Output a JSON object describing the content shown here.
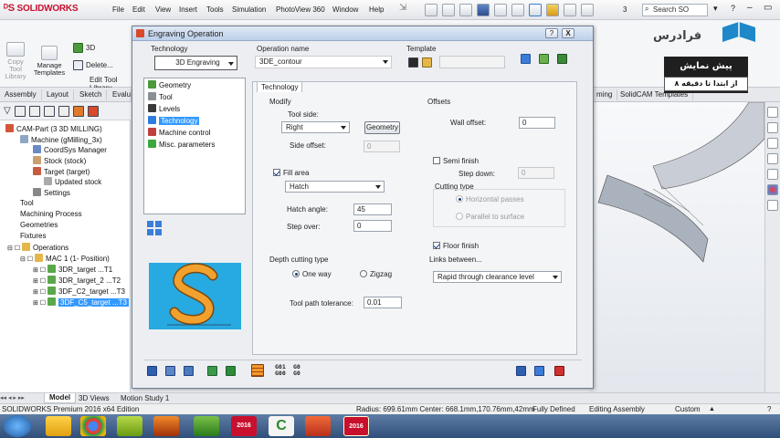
{
  "app": {
    "brand": "SOLIDWORKS",
    "menus": [
      "File",
      "Edit",
      "View",
      "Insert",
      "Tools",
      "Simulation",
      "PhotoView 360",
      "Window",
      "Help"
    ],
    "search_placeholder": "Search SO",
    "toolbar_item_3": "3"
  },
  "ribbon": {
    "copy_tool_library": "Copy\nTool\nLibrary",
    "manage_templates": "Manage\nTemplates",
    "btn_3d": "3D",
    "btn_delete": "Delete...",
    "btn_edit_tool_library": "Edit Tool Library"
  },
  "command_tabs": [
    "Assembly",
    "Layout",
    "Sketch",
    "Evalu"
  ],
  "command_tabs_right": [
    "ming",
    "SolidCAM Templates"
  ],
  "tree": {
    "root": "CAM-Part (3 3D MILLING)",
    "items": [
      "Machine (gMilling_3x)",
      "CoordSys Manager",
      "Stock (stock)",
      "Target (target)",
      "Updated stock",
      "Settings",
      "Tool",
      "Machining Process",
      "Geometries",
      "Fixtures",
      "Operations",
      "MAC 1 (1- Position)",
      "3DR_target ...T1",
      "3DR_target_2 ...T2",
      "3DF_C2_target ...T3",
      "3DF_C5_target ...T3"
    ]
  },
  "dialog": {
    "title": "Engraving Operation",
    "help": "?",
    "close": "X",
    "technology_label": "Technology",
    "technology_value": "3D Engraving",
    "operation_name_label": "Operation name",
    "operation_name_value": "3DE_contour",
    "template_label": "Template",
    "nav": [
      "Geometry",
      "Tool",
      "Levels",
      "Technology",
      "Machine control",
      "Misc. parameters"
    ],
    "tab": "Technology",
    "modify_title": "Modify",
    "tool_side_label": "Tool side:",
    "tool_side_value": "Right",
    "geometry_button": "Geometry",
    "side_offset_label": "Side offset:",
    "side_offset_value": "0",
    "fill_area_label": "Fill area",
    "hatch_value": "Hatch",
    "hatch_angle_label": "Hatch angle:",
    "hatch_angle_value": "45",
    "step_over_label": "Step over:",
    "step_over_value": "0",
    "offsets_title": "Offsets",
    "wall_offset_label": "Wall offset:",
    "wall_offset_value": "0",
    "semi_finish_label": "Semi finish",
    "step_down_label": "Step down:",
    "step_down_value": "0",
    "cutting_type_label": "Cutting type",
    "horizontal_passes": "Horizontal passes",
    "parallel_to_surface": "Parallel to surface",
    "floor_finish_label": "Floor finish",
    "depth_cutting_type": "Depth cutting type",
    "one_way": "One way",
    "zigzag": "Zigzag",
    "links_between": "Links between...",
    "links_value": "Rapid through clearance level",
    "tolerance_label": "Tool path tolerance:",
    "tolerance_value": "0.01",
    "gcode_1": "G01\nG00",
    "gcode_2": "G0\nG0"
  },
  "overlay": {
    "brand_fa": "فرادرس",
    "promo_line1": "پیش نمایش",
    "promo_line2": "از ابتدا تا دقیقه ۸"
  },
  "bottom_tabs": [
    "Model",
    "3D Views",
    "Motion Study 1"
  ],
  "status": {
    "edition": "SOLIDWORKS Premium 2016 x64 Edition",
    "coords": "Radius: 699.61mm  Center: 668.1mm,170.76mm,42mm",
    "defined": "Fully Defined",
    "mode": "Editing Assembly",
    "units": "Custom"
  },
  "taskbar": {
    "sw_label": "2016"
  },
  "colors": {
    "accent": "#3399ff",
    "brand_red": "#c8102e",
    "preview_bg": "#27a9e1",
    "preview_s": "#f2a12e"
  }
}
